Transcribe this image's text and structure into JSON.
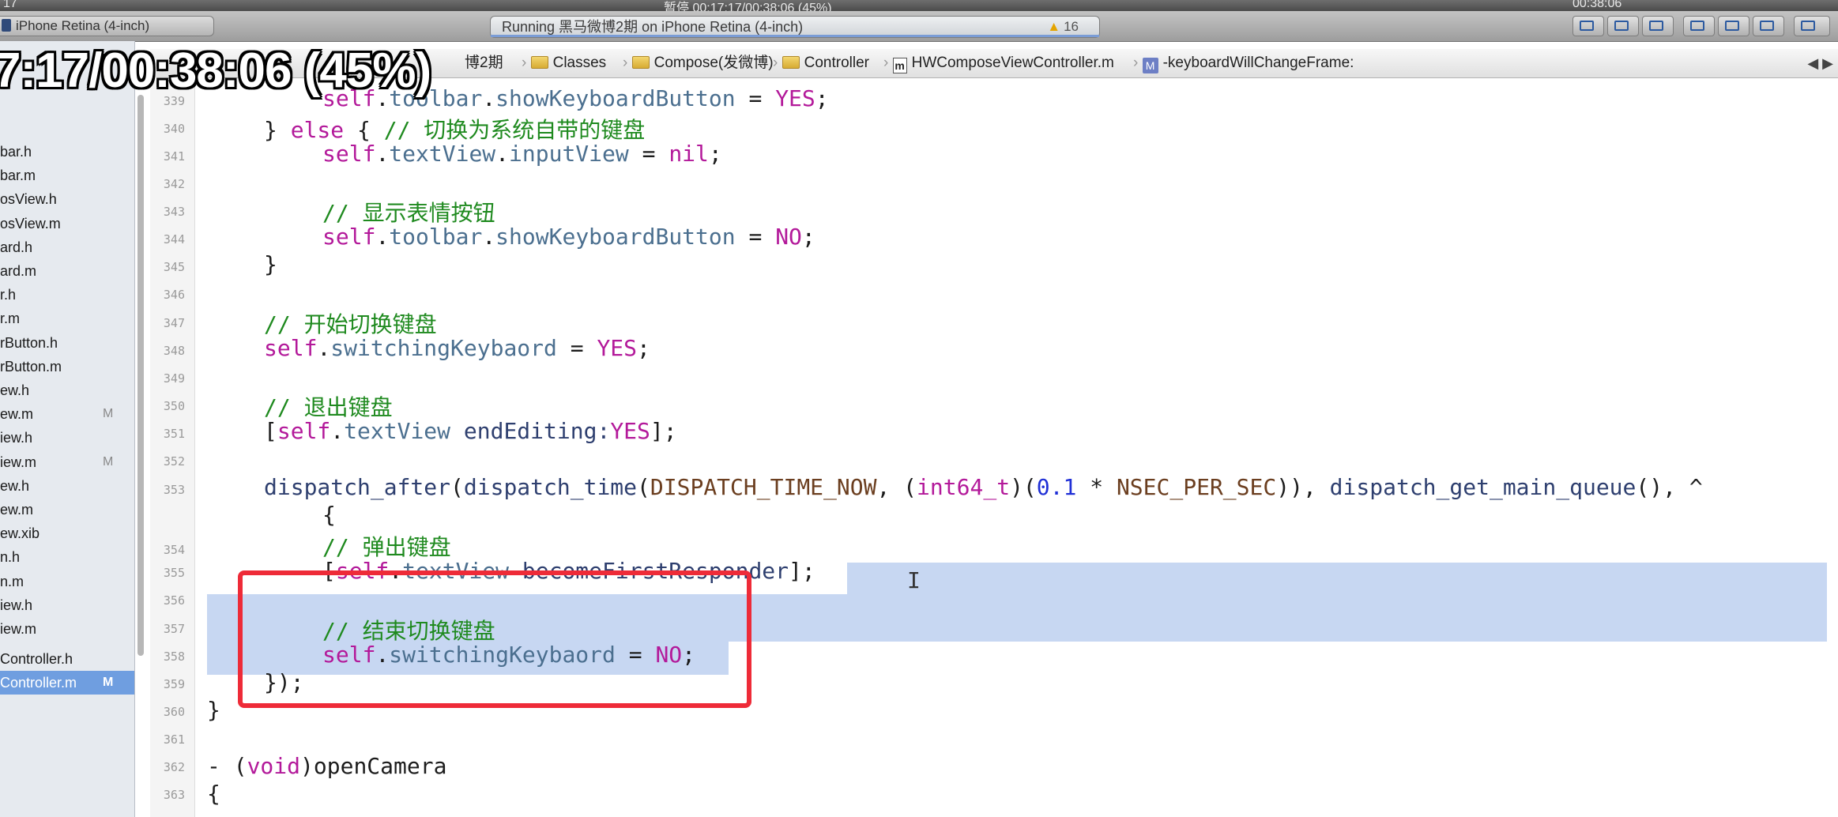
{
  "menubar": {
    "left_fragment": "17",
    "center_text": "暂停 00:17:17/00:38:06 (45%)",
    "right_time": "00:38:06"
  },
  "toolbar": {
    "scheme_label": "iPhone Retina (4-inch)",
    "activity_status": "Running 黑马微博2期 on iPhone Retina (4-inch)",
    "warning_count": "16",
    "warning_icon": "warning-triangle-icon"
  },
  "overlay": {
    "playback_time": "7:17/00:38:06 (45%)"
  },
  "navigator": {
    "files": [
      {
        "name": "bar.h",
        "badge": ""
      },
      {
        "name": "bar.m",
        "badge": ""
      },
      {
        "name": "osView.h",
        "badge": ""
      },
      {
        "name": "osView.m",
        "badge": ""
      },
      {
        "name": "ard.h",
        "badge": ""
      },
      {
        "name": "ard.m",
        "badge": ""
      },
      {
        "name": "r.h",
        "badge": ""
      },
      {
        "name": "r.m",
        "badge": ""
      },
      {
        "name": "rButton.h",
        "badge": ""
      },
      {
        "name": "rButton.m",
        "badge": ""
      },
      {
        "name": "ew.h",
        "badge": ""
      },
      {
        "name": "ew.m",
        "badge": "M"
      },
      {
        "name": "iew.h",
        "badge": ""
      },
      {
        "name": "iew.m",
        "badge": "M"
      },
      {
        "name": "ew.h",
        "badge": ""
      },
      {
        "name": "ew.m",
        "badge": ""
      },
      {
        "name": "ew.xib",
        "badge": ""
      },
      {
        "name": "n.h",
        "badge": ""
      },
      {
        "name": "n.m",
        "badge": ""
      },
      {
        "name": "iew.h",
        "badge": ""
      },
      {
        "name": "iew.m",
        "badge": ""
      },
      {
        "name": "Controller.h",
        "badge": ""
      },
      {
        "name": "Controller.m",
        "badge": "M"
      }
    ]
  },
  "jumpbar": {
    "project_fragment": "博2期",
    "crumbs": [
      "Classes",
      "Compose(发微博)",
      "Controller",
      "HWComposeViewController.m",
      "-keyboardWillChangeFrame:"
    ],
    "file_icon_letter": "m",
    "method_icon_letter": "M"
  },
  "editor": {
    "line_numbers": [
      "339",
      "340",
      "341",
      "342",
      "343",
      "344",
      "345",
      "346",
      "347",
      "348",
      "349",
      "350",
      "351",
      "352",
      "353",
      "354",
      "355",
      "356",
      "357",
      "358",
      "359",
      "360",
      "361",
      "362",
      "363"
    ],
    "lines": {
      "l339_obj": "self",
      "l339_dot1": ".",
      "l339_prop": "toolbar",
      "l339_dot2": ".",
      "l339_prop2": "showKeyboardButton",
      "l339_eq": " = ",
      "l339_val": "YES",
      "l339_end": ";",
      "l340_a": "} ",
      "l340_kw": "else",
      "l340_b": " { ",
      "l340_cm": "// 切换为系统自带的键盘",
      "l341_obj": "self",
      "l341_rest_a": ".",
      "l341_prop": "textView",
      "l341_rest_b": ".",
      "l341_prop2": "inputView",
      "l341_eq": " = ",
      "l341_val": "nil",
      "l341_end": ";",
      "l343_cm": "// 显示表情按钮",
      "l344_obj": "self",
      "l344_d1": ".",
      "l344_prop": "toolbar",
      "l344_d2": ".",
      "l344_prop2": "showKeyboardButton",
      "l344_eq": " = ",
      "l344_val": "NO",
      "l344_end": ";",
      "l345": "}",
      "l347_cm": "// 开始切换键盘",
      "l348_obj": "self",
      "l348_d": ".",
      "l348_prop": "switchingKeybaord",
      "l348_eq": " = ",
      "l348_val": "YES",
      "l348_end": ";",
      "l350_cm": "// 退出键盘",
      "l351_a": "[",
      "l351_obj": "self",
      "l351_d": ".",
      "l351_prop": "textView",
      "l351_b": " endEditing:",
      "l351_val": "YES",
      "l351_end": "];",
      "l353_fn": "dispatch_after",
      "l353_a": "(",
      "l353_fn2": "dispatch_time",
      "l353_b": "(",
      "l353_mac": "DISPATCH_TIME_NOW",
      "l353_c": ", (",
      "l353_type": "int64_t",
      "l353_d": ")(",
      "l353_num": "0.1",
      "l353_e": " * ",
      "l353_mac2": "NSEC_PER_SEC",
      "l353_f": ")), ",
      "l353_fn3": "dispatch_get_main_queue",
      "l353_g": "(), ^",
      "l353b": "{",
      "l354_cm": "// 弹出键盘",
      "l355_a": "[",
      "l355_obj": "self",
      "l355_d": ".",
      "l355_prop": "textView",
      "l355_b": " becomeFirstResponder",
      "l355_end": "];",
      "l357_cm": "// 结束切换键盘",
      "l358_obj": "self",
      "l358_d": ".",
      "l358_prop": "switchingKeybaord",
      "l358_eq": " = ",
      "l358_val": "NO",
      "l358_end": ";",
      "l359": "});",
      "l360": "}",
      "l362_a": "- (",
      "l362_kw": "void",
      "l362_b": ")openCamera",
      "l363": "{"
    }
  },
  "colors": {
    "highlight_box": "#ee2b38",
    "selection": "#c7d7f2",
    "keyword": "#b3199a",
    "comment": "#1f8a1f"
  }
}
